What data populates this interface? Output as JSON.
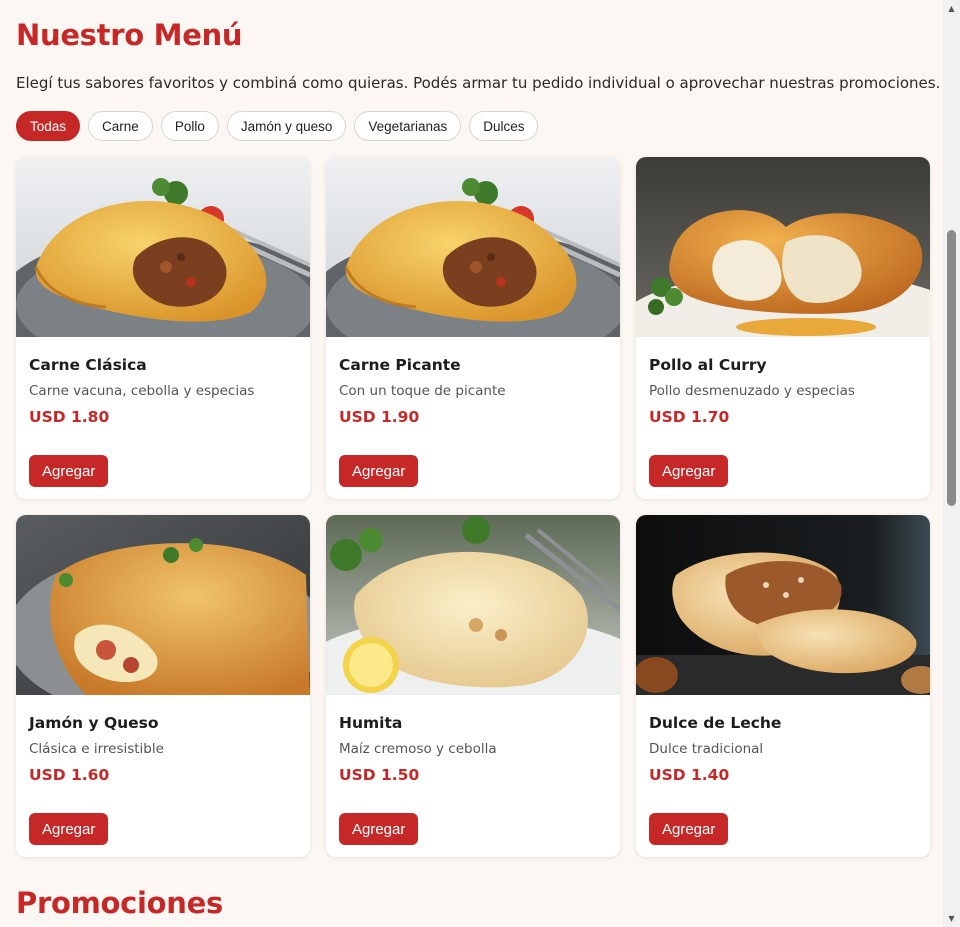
{
  "page": {
    "title": "Nuestro Menú",
    "intro": "Elegí tus sabores favoritos y combiná como quieras. Podés armar tu pedido individual o aprovechar nuestras promociones.",
    "section2_title": "Promociones"
  },
  "filters": [
    {
      "label": "Todas",
      "active": true
    },
    {
      "label": "Carne",
      "active": false
    },
    {
      "label": "Pollo",
      "active": false
    },
    {
      "label": "Jamón y queso",
      "active": false
    },
    {
      "label": "Vegetarianas",
      "active": false
    },
    {
      "label": "Dulces",
      "active": false
    }
  ],
  "products": [
    {
      "name": "Carne Clásica",
      "desc": "Carne vacuna, cebolla y especias",
      "price": "USD 1.80",
      "button": "Agregar",
      "image": "empanada-carne-photo"
    },
    {
      "name": "Carne Picante",
      "desc": "Con un toque de picante",
      "price": "USD 1.90",
      "button": "Agregar",
      "image": "empanada-carne-photo"
    },
    {
      "name": "Pollo al Curry",
      "desc": "Pollo desmenuzado y especias",
      "price": "USD 1.70",
      "button": "Agregar",
      "image": "empanada-pollo-photo"
    },
    {
      "name": "Jamón y Queso",
      "desc": "Clásica e irresistible",
      "price": "USD 1.60",
      "button": "Agregar",
      "image": "empanada-jamon-queso-photo"
    },
    {
      "name": "Humita",
      "desc": "Maíz cremoso y cebolla",
      "price": "USD 1.50",
      "button": "Agregar",
      "image": "empanada-humita-photo"
    },
    {
      "name": "Dulce de Leche",
      "desc": "Dulce tradicional",
      "price": "USD 1.40",
      "button": "Agregar",
      "image": "empanada-dulce-photo"
    }
  ],
  "colors": {
    "accent": "#c62828",
    "background": "#fdf7f3",
    "card": "#ffffff"
  }
}
